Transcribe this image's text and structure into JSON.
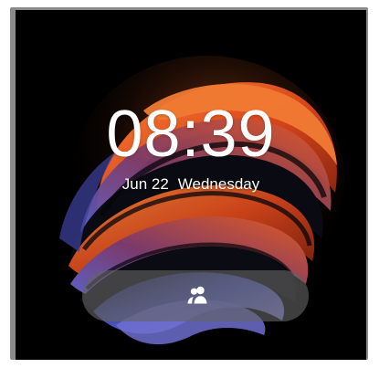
{
  "lockscreen": {
    "time": "08:39",
    "date": "Jun 22",
    "weekday": "Wednesday"
  },
  "unlock": {
    "icon": "users-icon"
  },
  "colors": {
    "background": "#000000",
    "wave_orange": "#e0571f",
    "wave_blue": "#4a5ac8",
    "pill": "#646464",
    "text": "#ffffff"
  }
}
